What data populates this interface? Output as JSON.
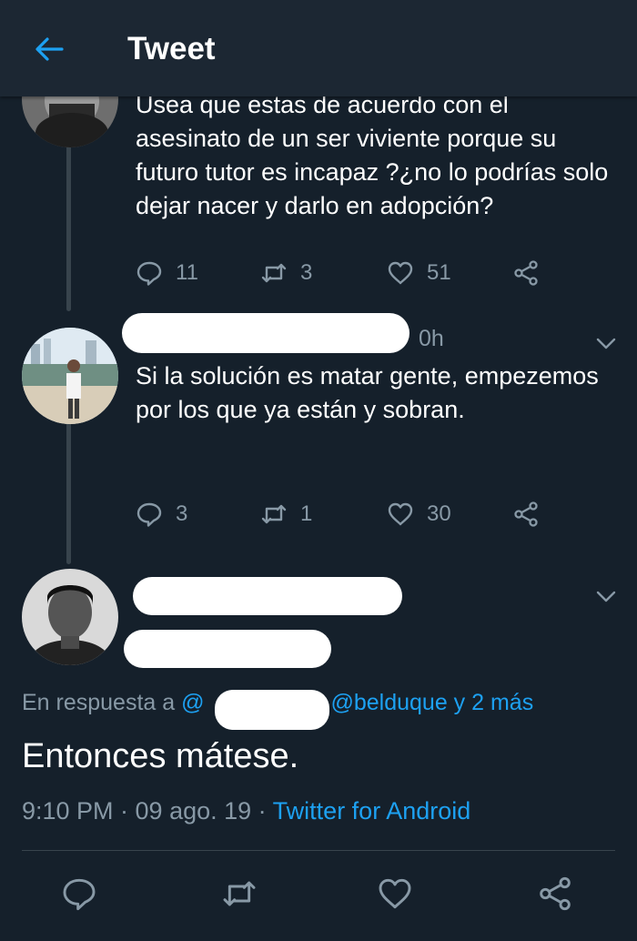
{
  "header": {
    "title": "Tweet",
    "back_icon": "back-arrow-icon"
  },
  "tweets": [
    {
      "text": "Usea que estas de acuerdo con el asesinato de un ser viviente porque su futuro tutor es incapaz ?¿no lo podrías solo dejar nacer y darlo en adopción?",
      "replies": "11",
      "retweets": "3",
      "likes": "51"
    },
    {
      "time_fragment": "0h",
      "text": "Si la solución es matar gente, empezemos por los que ya están y sobran.",
      "replies": "3",
      "retweets": "1",
      "likes": "30"
    }
  ],
  "main_tweet": {
    "reply_prefix": "En respuesta a",
    "mention_start": "@",
    "mentions": "@belduque y 2 más",
    "text": "Entonces mátese.",
    "timestamp": "9:10 PM · 09 ago. 19 · ",
    "source": "Twitter for Android"
  },
  "colors": {
    "background": "#15202b",
    "header": "#1c2733",
    "accent": "#1da1f2",
    "secondary_text": "#8899a6",
    "divider": "#38444d"
  }
}
